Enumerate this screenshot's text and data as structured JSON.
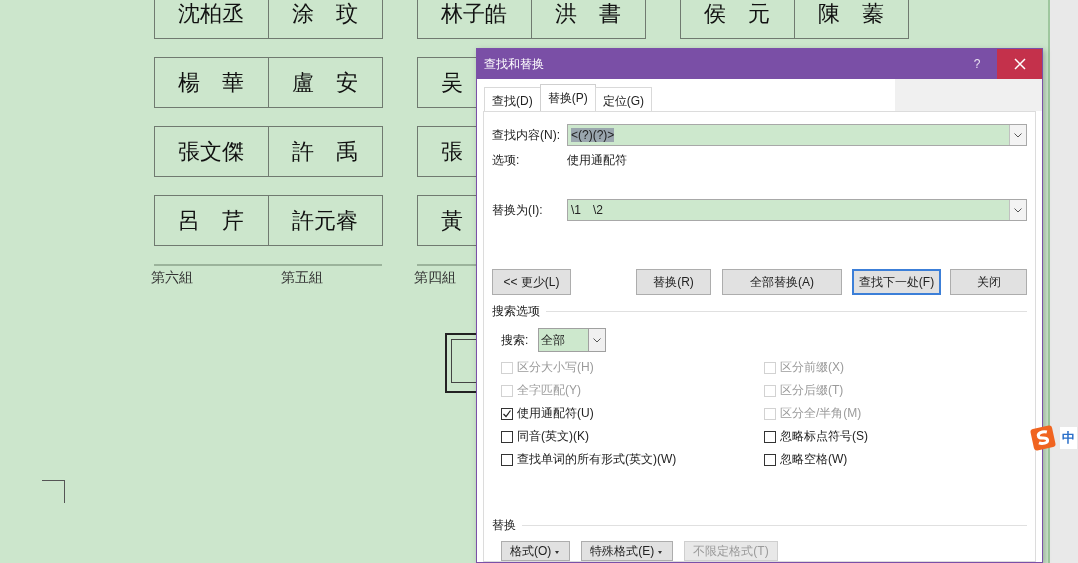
{
  "document": {
    "groups": [
      {
        "rows": [
          [
            "沈柏丞",
            "涂　玟"
          ],
          [
            "楊　華",
            "盧　安"
          ],
          [
            "張文傑",
            "許　禹"
          ],
          [
            "呂　芹",
            "許元睿"
          ]
        ],
        "labels": [
          "第六組",
          "第五組"
        ]
      },
      {
        "rows": [
          [
            "林子皓",
            "洪　書"
          ],
          [
            "吴"
          ],
          [
            "張"
          ],
          [
            "黃"
          ]
        ],
        "labels": [
          "第四組"
        ]
      },
      {
        "rows": [
          [
            "侯　元",
            "陳　蓁"
          ]
        ]
      }
    ]
  },
  "dialog": {
    "title": "查找和替换",
    "help": "?",
    "tabs": [
      {
        "label": "查找(D)",
        "selected": false
      },
      {
        "label": "替换(P)",
        "selected": true
      },
      {
        "label": "定位(G)",
        "selected": false
      }
    ],
    "find": {
      "label": "查找内容(N):",
      "value": "<(?)(?)>",
      "highlighted": true
    },
    "options": {
      "label": "选项:",
      "value": "使用通配符"
    },
    "replace": {
      "label": "替换为(I):",
      "value": "\\1　\\2"
    },
    "buttons": [
      {
        "label": "<< 更少(L)",
        "focused": false
      },
      {
        "label": "替换(R)",
        "focused": false
      },
      {
        "label": "全部替换(A)",
        "focused": false
      },
      {
        "label": "查找下一处(F)",
        "focused": true
      },
      {
        "label": "关闭",
        "focused": false
      }
    ],
    "search_section": "搜索选项",
    "search": {
      "label": "搜索:",
      "value": "全部"
    },
    "checkboxes_left": [
      {
        "label": "区分大小写(H)",
        "checked": false,
        "disabled": true
      },
      {
        "label": "全字匹配(Y)",
        "checked": false,
        "disabled": true
      },
      {
        "label": "使用通配符(U)",
        "checked": true,
        "disabled": false
      },
      {
        "label": "同音(英文)(K)",
        "checked": false,
        "disabled": false
      },
      {
        "label": "查找单词的所有形式(英文)(W)",
        "checked": false,
        "disabled": false
      }
    ],
    "checkboxes_right": [
      {
        "label": "区分前缀(X)",
        "checked": false,
        "disabled": true
      },
      {
        "label": "区分后缀(T)",
        "checked": false,
        "disabled": true
      },
      {
        "label": "区分全/半角(M)",
        "checked": false,
        "disabled": true
      },
      {
        "label": "忽略标点符号(S)",
        "checked": false,
        "disabled": false
      },
      {
        "label": "忽略空格(W)",
        "checked": false,
        "disabled": false
      }
    ],
    "replace_section": "替换",
    "bottom_buttons": [
      {
        "label": "格式(O)",
        "dropdown": true,
        "disabled": false
      },
      {
        "label": "特殊格式(E)",
        "dropdown": true,
        "disabled": false
      },
      {
        "label": "不限定格式(T)",
        "dropdown": false,
        "disabled": true
      }
    ]
  },
  "ime": {
    "label": "中"
  }
}
